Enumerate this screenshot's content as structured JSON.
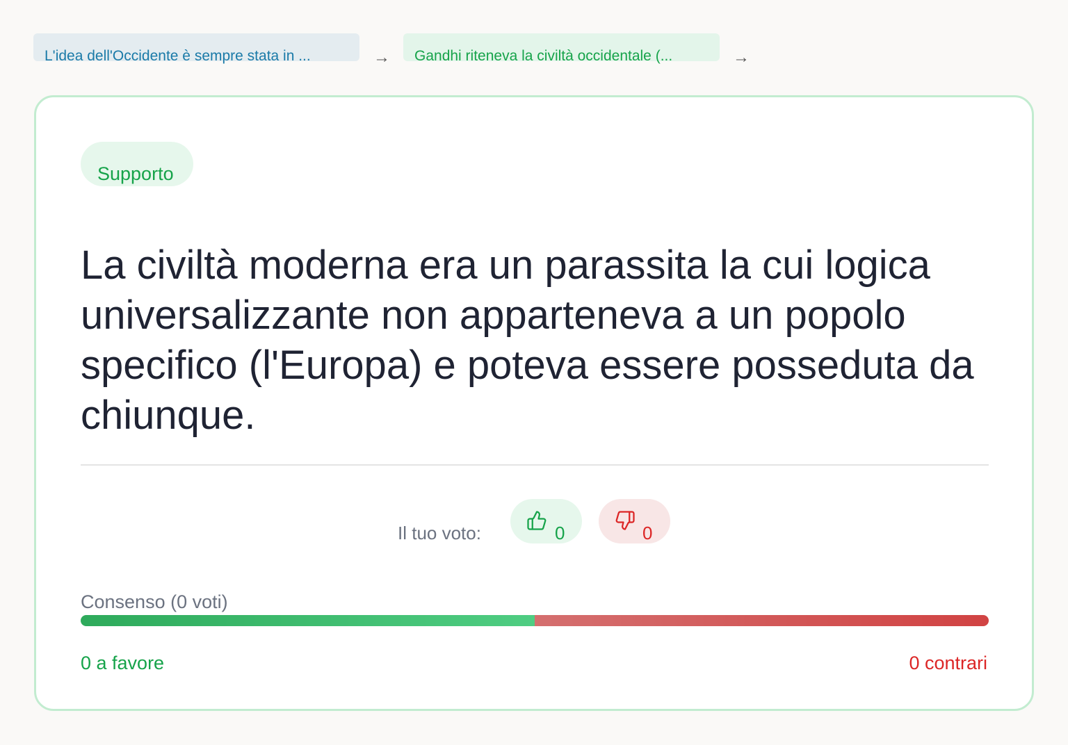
{
  "breadcrumb": {
    "items": [
      {
        "label": "L'idea dell'Occidente è sempre stata in ..."
      },
      {
        "label": "Gandhi riteneva la civiltà occidentale (..."
      }
    ],
    "separator": "→"
  },
  "claim": {
    "badge": "Supporto",
    "text": "La civiltà moderna era un parassita la cui logica universalizzante non apparteneva a un popolo specifico (l'Europa) e poteva essere posseduta da chiunque."
  },
  "voting": {
    "label": "Il tuo voto:",
    "upvotes": "0",
    "downvotes": "0",
    "up_icon": "thumbs-up-icon",
    "down_icon": "thumbs-down-icon"
  },
  "consensus": {
    "label": "Consenso (0 voti)",
    "for_fraction": 0.5,
    "for_text": "0 a favore",
    "against_text": "0 contrari"
  },
  "colors": {
    "support": "#16a34a",
    "oppose": "#dc2626",
    "card_border": "#c2ecd0"
  }
}
